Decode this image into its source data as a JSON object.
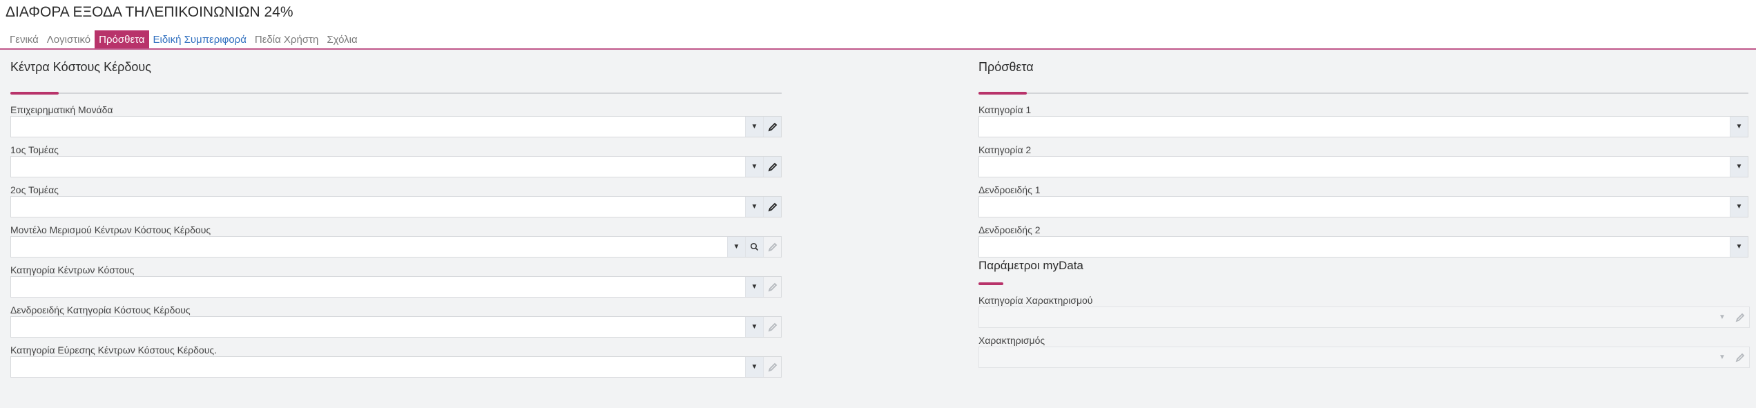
{
  "window": {
    "title": "ΔΙΑΦΟΡΑ ΕΞΟΔΑ ΤΗΛΕΠΙΚΟΙΝΩΝΙΩΝ 24%"
  },
  "tabs": [
    {
      "label": "Γενικά",
      "state": "normal"
    },
    {
      "label": "Λογιστικό",
      "state": "normal"
    },
    {
      "label": "Πρόσθετα",
      "state": "active"
    },
    {
      "label": "Ειδική Συμπεριφορά",
      "state": "highlight"
    },
    {
      "label": "Πεδία Χρήστη",
      "state": "normal"
    },
    {
      "label": "Σχόλια",
      "state": "normal"
    }
  ],
  "colors": {
    "accent": "#b8336a",
    "link": "#2f6fbf",
    "panel_bg": "#f2f3f4"
  },
  "left_section": {
    "title": "Κέντρα Κόστους Κέρδους",
    "fields": [
      {
        "label": "Επιχειρηματική Μονάδα",
        "value": "",
        "icons": [
          "chevron-down-icon",
          "pencil-icon"
        ]
      },
      {
        "label": "1ος Τομέας",
        "value": "",
        "icons": [
          "chevron-down-icon",
          "pencil-icon"
        ]
      },
      {
        "label": "2ος Τομέας",
        "value": "",
        "icons": [
          "chevron-down-icon",
          "pencil-icon"
        ]
      },
      {
        "label": "Μοντέλο Μερισμού Κέντρων Κόστους Κέρδους",
        "value": "",
        "icons": [
          "chevron-down-icon",
          "search-icon",
          "pencil-icon-disabled"
        ]
      },
      {
        "label": "Κατηγορία Κέντρων Κόστους",
        "value": "",
        "icons": [
          "chevron-down-icon",
          "pencil-icon-disabled"
        ]
      },
      {
        "label": "Δενδροειδής Κατηγορία Κόστους Κέρδους",
        "value": "",
        "icons": [
          "chevron-down-icon",
          "pencil-icon-disabled"
        ]
      },
      {
        "label": "Κατηγορία Εύρεσης Κέντρων Κόστους Κέρδους.",
        "value": "",
        "icons": [
          "chevron-down-icon",
          "pencil-icon-disabled"
        ]
      }
    ]
  },
  "right_section": {
    "title": "Πρόσθετα",
    "fields": [
      {
        "label": "Κατηγορία 1",
        "value": ""
      },
      {
        "label": "Κατηγορία 2",
        "value": ""
      },
      {
        "label": "Δενδροειδής 1",
        "value": ""
      },
      {
        "label": "Δενδροειδής 2",
        "value": ""
      }
    ]
  },
  "mydata_section": {
    "title": "Παράμετροι myData",
    "fields": [
      {
        "label": "Κατηγορία Χαρακτηρισμού",
        "value": "",
        "disabled": true
      },
      {
        "label": "Χαρακτηρισμός",
        "value": "",
        "disabled": true
      }
    ]
  }
}
